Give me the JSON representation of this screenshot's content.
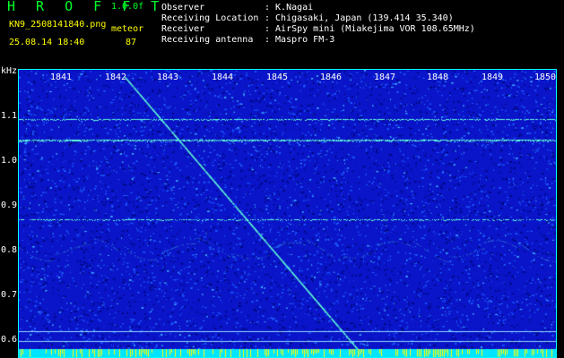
{
  "header": {
    "app_title": "H R O F F T",
    "version": "1.0.0f",
    "file_name": "KN9_2508141840.png",
    "timestamp": "25.08.14 18:40",
    "mode_label": "meteor",
    "mode_value": "87",
    "meta": [
      {
        "label": "Observer",
        "value": ": K.Nagai"
      },
      {
        "label": "Receiving Location",
        "value": ": Chigasaki, Japan (139.414 35.340)"
      },
      {
        "label": "Receiver",
        "value": ": AirSpy mini (Miakejima VOR 108.65MHz)"
      },
      {
        "label": "Receiving antenna",
        "value": ": Maspro FM-3"
      }
    ]
  },
  "spectrogram": {
    "unit": "kHz",
    "x_ticks": [
      "1841",
      "1842",
      "1843",
      "1844",
      "1845",
      "1846",
      "1847",
      "1848",
      "1849",
      "1850"
    ],
    "y_ticks": [
      "1.1",
      "1.0",
      "0.9",
      "0.8",
      "0.7",
      "0.6"
    ],
    "colors": {
      "background": "#0a14c8",
      "noise_dark": "#000a78",
      "noise_light": "#1e5aff",
      "signal": "#60ffd8",
      "baseline": "#00e5ff",
      "baseline_mark": "#ffff00",
      "frame": "#00ffff"
    }
  }
}
